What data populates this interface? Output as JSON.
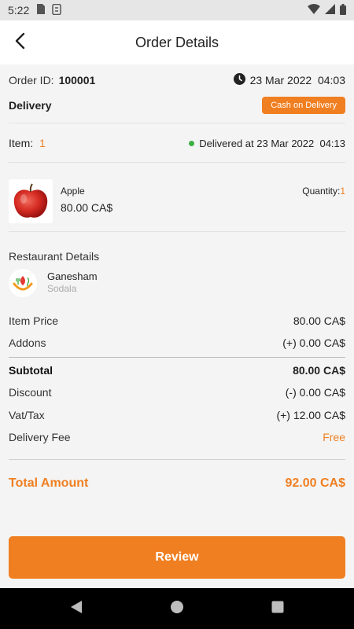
{
  "status_bar": {
    "time": "5:22"
  },
  "header": {
    "title": "Order Details"
  },
  "order": {
    "id_label": "Order ID:",
    "id_value": "100001",
    "date": "23 Mar 2022  04:03",
    "delivery_label": "Delivery",
    "payment_badge": "Cash on Delivery"
  },
  "items": {
    "label": "Item:",
    "count": "1",
    "status": "Delivered at 23 Mar 2022  04:13"
  },
  "product": {
    "name": "Apple",
    "price": "80.00 CA$",
    "quantity_label": "Quantity:",
    "quantity_value": "1"
  },
  "restaurant": {
    "title": "Restaurant Details",
    "name": "Ganesham",
    "location": "Sodala"
  },
  "pricing": {
    "item_price_label": "Item Price",
    "item_price_value": "80.00 CA$",
    "addons_label": "Addons",
    "addons_value": "(+) 0.00 CA$",
    "subtotal_label": "Subtotal",
    "subtotal_value": "80.00 CA$",
    "discount_label": "Discount",
    "discount_value": "(-) 0.00 CA$",
    "vat_label": "Vat/Tax",
    "vat_value": "(+) 12.00 CA$",
    "delivery_fee_label": "Delivery Fee",
    "delivery_fee_value": "Free",
    "total_label": "Total Amount",
    "total_value": "92.00 CA$"
  },
  "actions": {
    "review_label": "Review"
  },
  "colors": {
    "accent": "#f07f21",
    "delivered": "#3cb043"
  },
  "icons": [
    "back-arrow-icon",
    "clock-icon",
    "wifi-icon",
    "signal-icon",
    "battery-icon",
    "apple-image",
    "restaurant-logo-icon",
    "nav-back-icon",
    "nav-home-icon",
    "nav-recents-icon"
  ]
}
